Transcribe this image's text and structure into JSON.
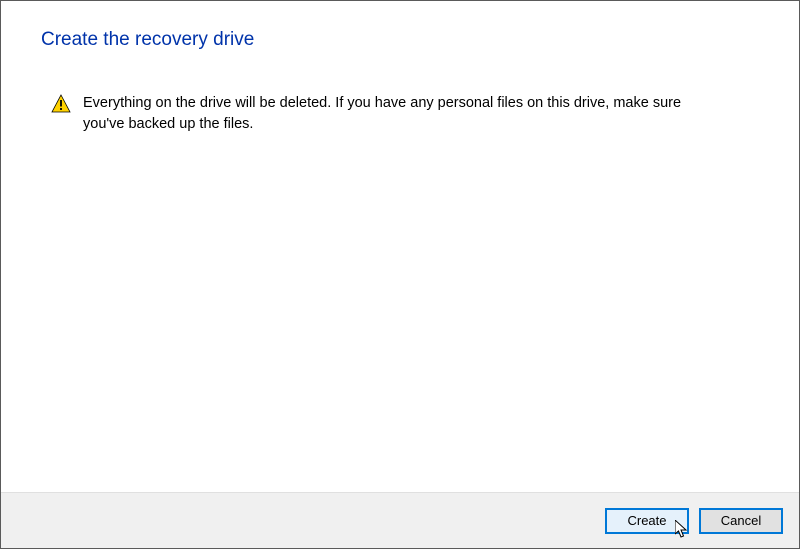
{
  "dialog": {
    "title": "Create the recovery drive",
    "warning_text": "Everything on the drive will be deleted. If you have any personal files on this drive, make sure you've backed up the files."
  },
  "buttons": {
    "create_label": "Create",
    "cancel_label": "Cancel"
  },
  "icons": {
    "warning": "warning-icon"
  },
  "colors": {
    "title": "#0033aa",
    "button_focus_border": "#0078d7",
    "button_bar_bg": "#f0f0f0"
  }
}
